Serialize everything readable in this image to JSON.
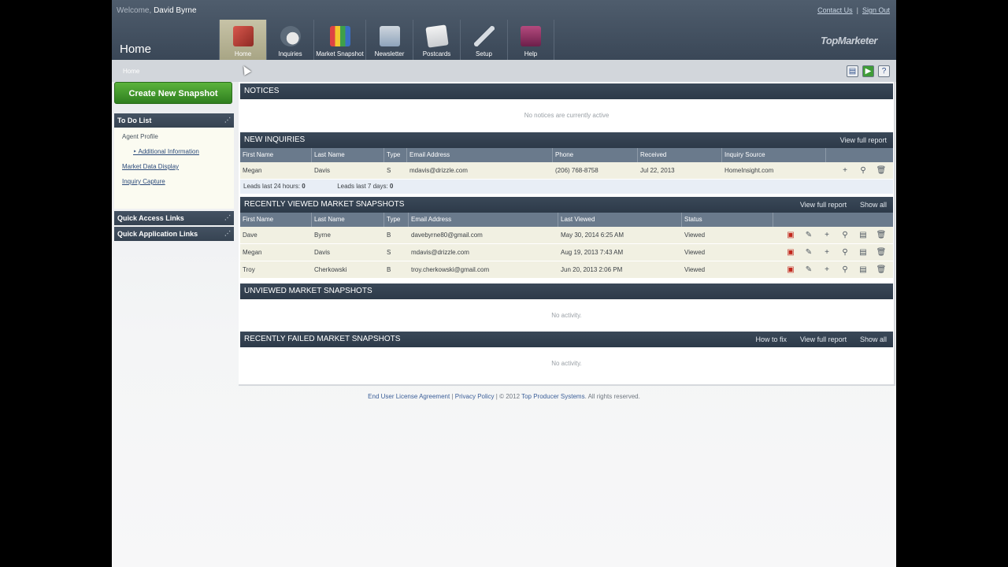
{
  "header": {
    "welcome_prefix": "Welcome,",
    "user_name": "David Byrne",
    "contact_us": "Contact Us",
    "separator": "|",
    "sign_out": "Sign Out",
    "page_title": "Home",
    "brand": "TopMarketer"
  },
  "nav": {
    "home": "Home",
    "inquiries": "Inquiries",
    "market_snapshot": "Market Snapshot",
    "newsletter": "Newsletter",
    "postcards": "Postcards",
    "setup": "Setup",
    "help": "Help"
  },
  "breadcrumb": "Home",
  "sidebar": {
    "create_button": "Create New Snapshot",
    "todo_title": "To Do List",
    "todo": {
      "agent_profile": "Agent Profile",
      "additional_information": "Additional Information",
      "market_data_display": "Market Data Display",
      "inquiry_capture": "Inquiry Capture"
    },
    "quick_access": "Quick Access Links",
    "quick_application": "Quick Application Links"
  },
  "notices": {
    "title": "NOTICES",
    "empty": "No notices are currently active"
  },
  "inquiries": {
    "title": "NEW INQUIRIES",
    "view_full_report": "View full report",
    "columns": {
      "first": "First Name",
      "last": "Last Name",
      "type": "Type",
      "email": "Email Address",
      "phone": "Phone",
      "received": "Received",
      "source": "Inquiry Source"
    },
    "rows": [
      {
        "first": "Megan",
        "last": "Davis",
        "type": "S",
        "email": "mdavis@drizzle.com",
        "phone": "(206) 768-8758",
        "received": "Jul 22, 2013",
        "source": "HomeInsight.com"
      }
    ],
    "leads_24h_label": "Leads last 24 hours:",
    "leads_24h": "0",
    "leads_7d_label": "Leads last 7 days:",
    "leads_7d": "0"
  },
  "viewed": {
    "title": "RECENTLY VIEWED MARKET SNAPSHOTS",
    "view_full_report": "View full report",
    "show_all": "Show all",
    "columns": {
      "first": "First Name",
      "last": "Last Name",
      "type": "Type",
      "email": "Email Address",
      "last_viewed": "Last Viewed",
      "status": "Status"
    },
    "rows": [
      {
        "first": "Dave",
        "last": "Byrne",
        "type": "B",
        "email": "davebyrne80@gmail.com",
        "last_viewed": "May 30, 2014 6:25 AM",
        "status": "Viewed"
      },
      {
        "first": "Megan",
        "last": "Davis",
        "type": "S",
        "email": "mdavis@drizzle.com",
        "last_viewed": "Aug 19, 2013 7:43 AM",
        "status": "Viewed"
      },
      {
        "first": "Troy",
        "last": "Cherkowski",
        "type": "B",
        "email": "troy.cherkowski@gmail.com",
        "last_viewed": "Jun 20, 2013 2:06 PM",
        "status": "Viewed"
      }
    ]
  },
  "unviewed": {
    "title": "UNVIEWED MARKET SNAPSHOTS",
    "empty": "No activity."
  },
  "failed": {
    "title": "RECENTLY FAILED MARKET SNAPSHOTS",
    "how_to_fix": "How to fix",
    "view_full_report": "View full report",
    "show_all": "Show all",
    "empty": "No activity."
  },
  "footer": {
    "eula": "End User License Agreement",
    "sep": "|",
    "privacy": "Privacy Policy",
    "copyright": "| © 2012",
    "company": "Top Producer Systems",
    "rights": ". All rights reserved."
  },
  "colors": {
    "header_bg": "#3f4c5c",
    "nav_active": "#b8b596",
    "create_green": "#3f9a2a",
    "section_header": "#334050",
    "row_bg": "#f1f0e2"
  },
  "icons": {
    "nav": [
      "house-icon",
      "person-question-icon",
      "chart-icon",
      "newspaper-icon",
      "postcard-icon",
      "wrench-icon",
      "book-help-icon"
    ],
    "row_actions": [
      "pdf-icon",
      "edit-icon",
      "add-icon",
      "search-icon",
      "document-icon",
      "trash-icon"
    ]
  }
}
